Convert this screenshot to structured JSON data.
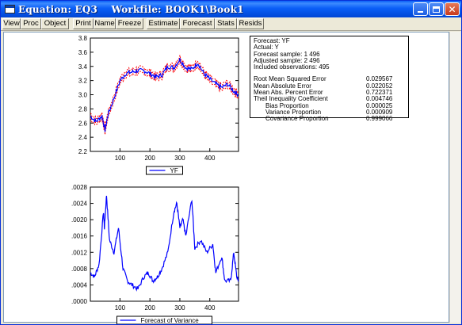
{
  "window": {
    "title": "Equation: EQ3    Workfile: BOOK1\\Book1",
    "controls": {
      "minimize": "minimize-icon",
      "maximize": "maximize-icon",
      "close": "close-icon"
    }
  },
  "toolbar": {
    "items": [
      "View",
      "Proc",
      "Object",
      "Print",
      "Name",
      "Freeze",
      "Estimate",
      "Forecast",
      "Stats",
      "Resids"
    ]
  },
  "stats_box": {
    "lines": [
      "Forecast: YF",
      "Actual: Y",
      "Forecast sample: 1 496",
      "Adjusted sample: 2 496",
      "Included observations: 495"
    ],
    "metrics": [
      {
        "label": "Root Mean Squared Error",
        "value": "0.029567"
      },
      {
        "label": "Mean Absolute Error",
        "value": "0.022052"
      },
      {
        "label": "Mean Abs. Percent Error",
        "value": "0.722371"
      },
      {
        "label": "Theil Inequality Coefficient",
        "value": "0.004746"
      }
    ],
    "sub_metrics": [
      {
        "label": "Bias Proportion",
        "value": "0.000025"
      },
      {
        "label": "Variance Proportion",
        "value": "0.000909"
      },
      {
        "label": "Covariance Proportion",
        "value": "0.999066"
      }
    ]
  },
  "chart_data": [
    {
      "type": "line",
      "title": "",
      "xlabel": "",
      "ylabel": "",
      "xlim": [
        1,
        496
      ],
      "ylim": [
        2.2,
        3.8
      ],
      "x_ticks": [
        "100",
        "200",
        "300",
        "400"
      ],
      "y_ticks": [
        "2.2",
        "2.4",
        "2.6",
        "2.8",
        "3.0",
        "3.2",
        "3.4",
        "3.6",
        "3.8"
      ],
      "legend": [
        "YF"
      ],
      "legend_position": "bottom-center",
      "series": [
        {
          "name": "YF",
          "color": "#0000ff",
          "band_color": "#ff0000",
          "x": [
            1,
            20,
            40,
            50,
            60,
            80,
            100,
            120,
            140,
            160,
            180,
            200,
            220,
            240,
            260,
            280,
            300,
            320,
            340,
            360,
            380,
            400,
            420,
            440,
            460,
            480,
            496
          ],
          "values": [
            2.7,
            2.62,
            2.7,
            2.5,
            2.72,
            2.95,
            3.2,
            3.3,
            3.32,
            3.34,
            3.34,
            3.3,
            3.25,
            3.28,
            3.4,
            3.38,
            3.5,
            3.38,
            3.36,
            3.45,
            3.3,
            3.22,
            3.15,
            3.1,
            3.15,
            3.05,
            3.0
          ]
        }
      ]
    },
    {
      "type": "line",
      "title": "",
      "xlabel": "",
      "ylabel": "",
      "xlim": [
        1,
        496
      ],
      "ylim": [
        0,
        0.0028
      ],
      "x_ticks": [
        "100",
        "200",
        "300",
        "400"
      ],
      "y_ticks": [
        ".0000",
        ".0004",
        ".0008",
        ".0012",
        ".0016",
        ".0020",
        ".0024",
        ".0028"
      ],
      "legend": [
        "Forecast of Variance"
      ],
      "legend_position": "bottom-center",
      "series": [
        {
          "name": "Forecast of Variance",
          "color": "#0000ff",
          "x": [
            1,
            15,
            30,
            45,
            48,
            55,
            65,
            80,
            95,
            110,
            125,
            140,
            160,
            180,
            195,
            210,
            225,
            240,
            260,
            280,
            290,
            300,
            310,
            320,
            340,
            350,
            370,
            390,
            410,
            420,
            440,
            450,
            470,
            480,
            490,
            496
          ],
          "values": [
            0.0007,
            0.0006,
            0.0009,
            0.0022,
            0.0018,
            0.0026,
            0.0015,
            0.0012,
            0.0018,
            0.0008,
            0.0005,
            0.0004,
            0.0003,
            0.0006,
            0.0007,
            0.0005,
            0.0006,
            0.0008,
            0.0012,
            0.0022,
            0.0024,
            0.0018,
            0.002,
            0.0016,
            0.0025,
            0.0013,
            0.0015,
            0.0012,
            0.0014,
            0.0007,
            0.0011,
            0.0005,
            0.0005,
            0.0012,
            0.0006,
            0.0005
          ]
        }
      ]
    }
  ]
}
